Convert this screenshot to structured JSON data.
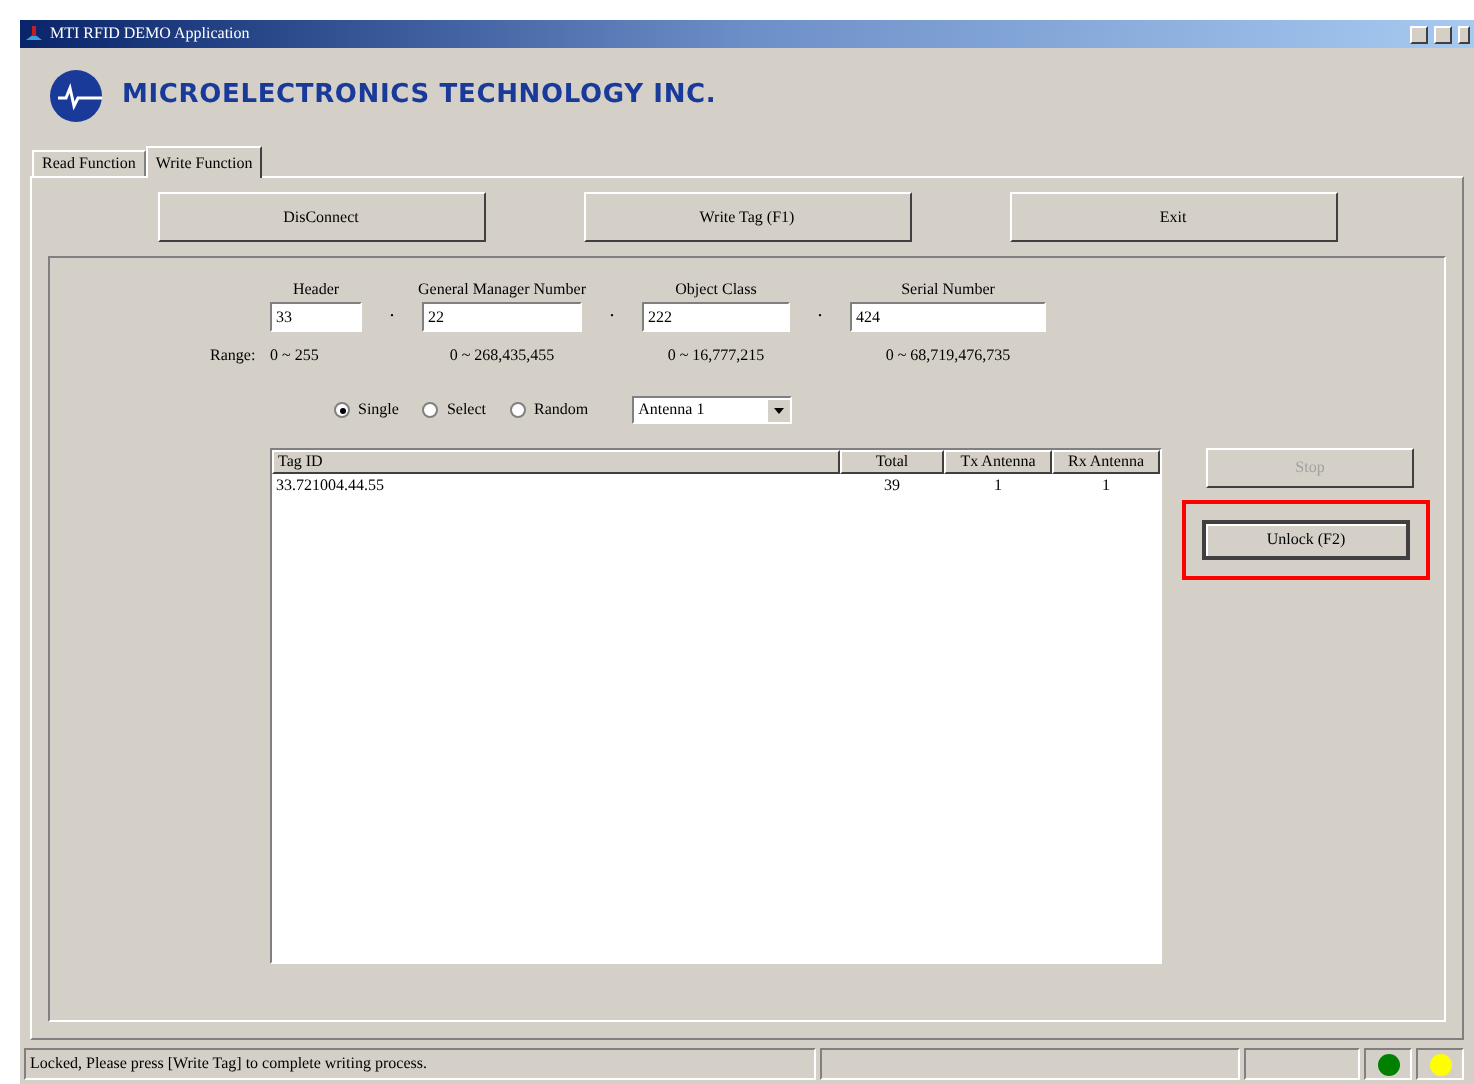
{
  "window": {
    "title": "MTI RFID DEMO Application"
  },
  "logo": {
    "text": "MICROELECTRONICS TECHNOLOGY INC."
  },
  "tabs": [
    {
      "label": "Read Function",
      "selected": false
    },
    {
      "label": "Write Function",
      "selected": true
    }
  ],
  "top_buttons": [
    "DisConnect",
    "Write Tag (F1)",
    "Exit"
  ],
  "fields": [
    {
      "label": "Header",
      "value": "33",
      "range": "0 ~ 255"
    },
    {
      "label": "General Manager Number",
      "value": "22",
      "range": "0 ~ 268,435,455"
    },
    {
      "label": "Object Class",
      "value": "222",
      "range": "0 ~ 16,777,215"
    },
    {
      "label": "Serial Number",
      "value": "424",
      "range": "0 ~ 68,719,476,735"
    }
  ],
  "separator": ".",
  "range_label": "Range:",
  "modes": [
    {
      "label": "Single",
      "selected": true
    },
    {
      "label": "Select",
      "selected": false
    },
    {
      "label": "Random",
      "selected": false
    }
  ],
  "antenna": {
    "value": "Antenna 1"
  },
  "table": {
    "columns": [
      "Tag ID",
      "Total",
      "Tx Antenna",
      "Rx Antenna"
    ],
    "rows": [
      [
        "33.721004.44.55",
        "39",
        "1",
        "1"
      ]
    ]
  },
  "side_buttons": [
    {
      "label": "Stop",
      "disabled": true,
      "highlighted": false
    },
    {
      "label": "Unlock  (F2)",
      "disabled": false,
      "highlighted": true
    }
  ],
  "status_bar": {
    "message": "Locked, Please press [Write Tag] to complete writing process.",
    "lights": [
      {
        "color": "#008000"
      },
      {
        "color": "#ffff00"
      }
    ]
  }
}
